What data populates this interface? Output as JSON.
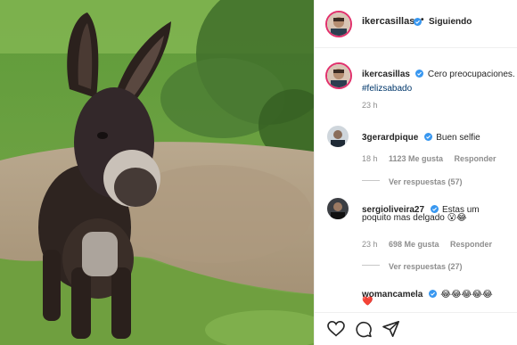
{
  "post": {
    "author": "ikercasillas",
    "follow_separator": "•",
    "follow_label": "Siguiendo",
    "caption": "Cero preocupaciones.",
    "hashtag": "#felizsabado",
    "caption_time": "23 h"
  },
  "comments": [
    {
      "username": "3gerardpique",
      "text": "Buen selfie",
      "time": "18 h",
      "likes": "1123 Me gusta",
      "reply": "Responder",
      "replies": "Ver respuestas (57)"
    },
    {
      "username": "sergioliveira27",
      "text": "Estas um",
      "text2": "poquito mas delgado 😮😂",
      "time": "23 h",
      "likes": "698 Me gusta",
      "reply": "Responder",
      "replies": "Ver respuestas (27)"
    },
    {
      "username": "womancamela",
      "text": "😂😂😂😂😂",
      "text2": "❤️"
    }
  ],
  "icons": {
    "verified": "verified-badge-icon",
    "like": "heart-icon",
    "comment": "comment-icon",
    "share": "paper-plane-icon"
  },
  "colors": {
    "verified": "#3897f0",
    "text": "#262626",
    "muted": "#8e8e8e",
    "hashtag": "#00376b",
    "avatar_ring": "#e1306c"
  }
}
